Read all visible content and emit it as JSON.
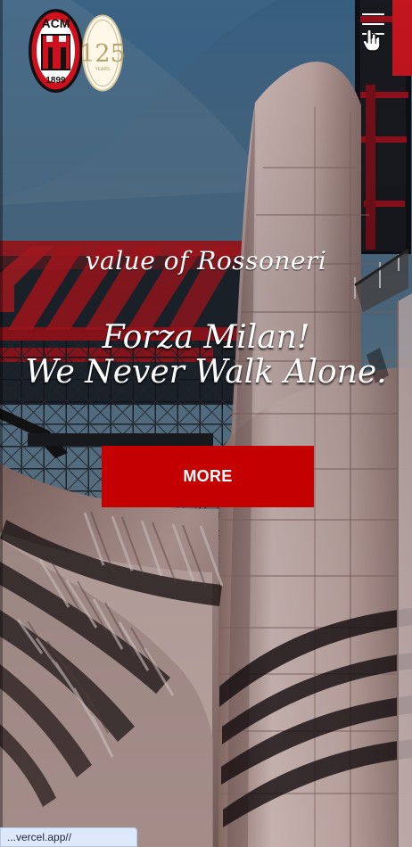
{
  "hero": {
    "tagline": "value of Rossoneri",
    "slogan_line_1": "Forza Milan!",
    "slogan_line_2": "We Never Walk Alone.",
    "button_label": "MORE"
  },
  "logos": {
    "club_text_top": "ACM",
    "club_year": "1899",
    "anniversary_number": "125",
    "anniversary_word": "YEARS"
  },
  "status_bar": {
    "url": "...vercel.app//"
  },
  "colors": {
    "brand_red": "#c40000",
    "white": "#ffffff",
    "status_bg": "#dde8fb"
  },
  "icons": {
    "menu": "hamburger-icon",
    "pointer": "hand-pointer-icon",
    "club_crest": "ac-milan-crest-icon",
    "anniversary_badge": "125-years-badge-icon"
  }
}
